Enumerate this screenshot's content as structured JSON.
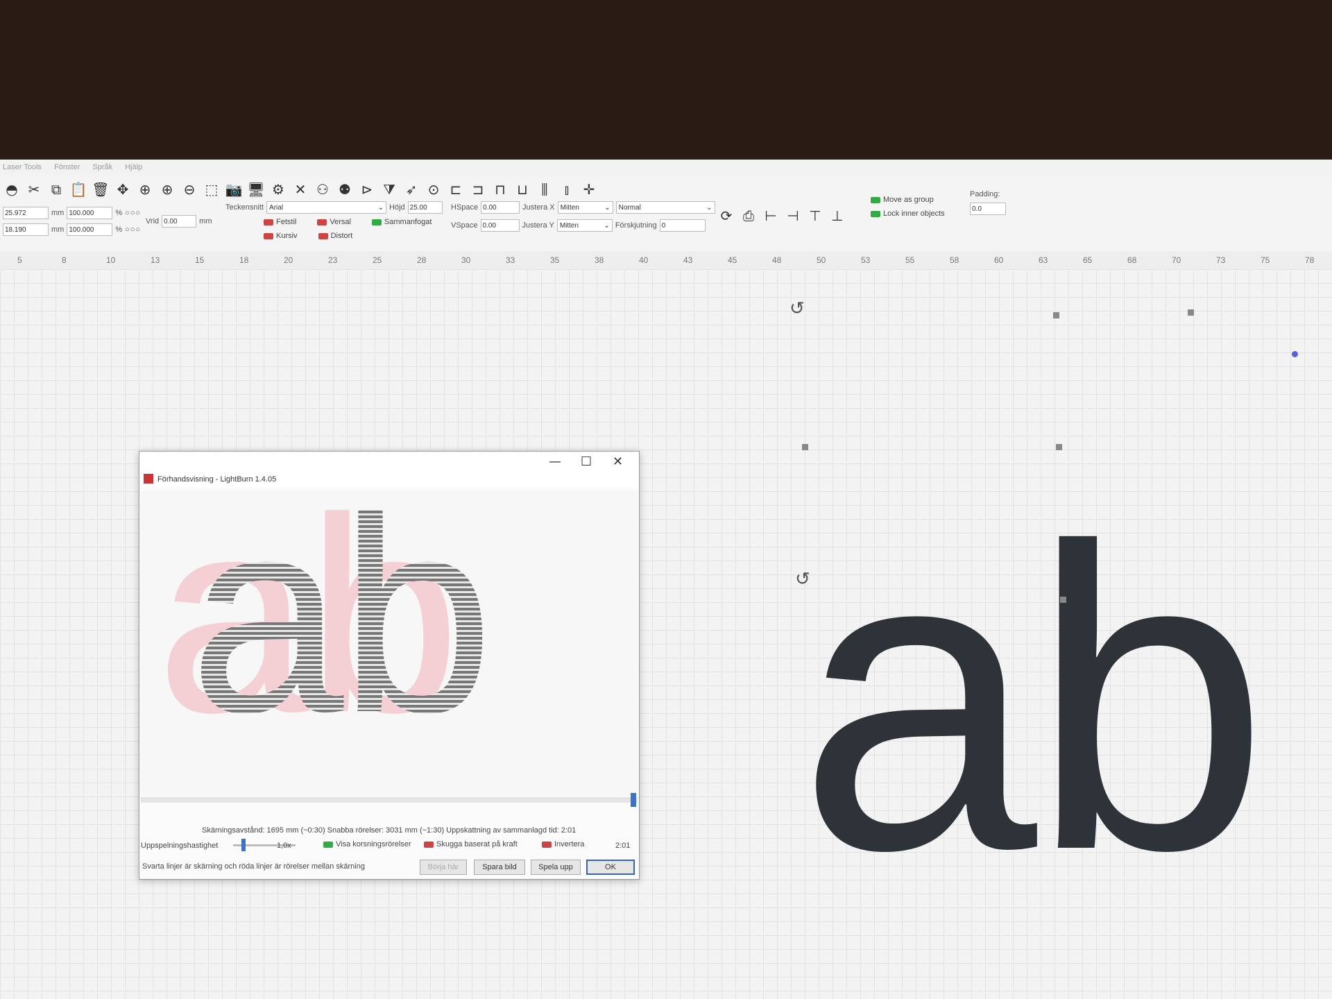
{
  "menu": [
    "Laser Tools",
    "Fönster",
    "Språk",
    "Hjälp"
  ],
  "toolbar": {
    "width": "25.972",
    "height": "18.190",
    "unit_mm": "mm",
    "scale_w": "100.000",
    "scale_h": "100.000",
    "percent": "%",
    "rotate_label": "Vrid",
    "rotate_value": "0.00",
    "font_label": "Teckensnitt",
    "font_value": "Arial",
    "bold": "Fetstil",
    "italic": "Kursiv",
    "upper": "Versal",
    "distort": "Distort",
    "welded": "Sammanfogat",
    "height_label": "Höjd",
    "height_value": "25.00",
    "hspace_label": "HSpace",
    "hspace_value": "0.00",
    "vspace_label": "VSpace",
    "vspace_value": "0.00",
    "align_x_label": "Justera X",
    "align_x_value": "Mitten",
    "align_y_label": "Justera Y",
    "align_y_value": "Mitten",
    "mode_value": "Normal",
    "offset_label": "Förskjutning",
    "offset_value": "0",
    "move_as_group": "Move as group",
    "lock_inner": "Lock inner objects",
    "padding_label": "Padding:",
    "padding_value": "0.0"
  },
  "ruler": [
    "5",
    "8",
    "10",
    "13",
    "15",
    "18",
    "20",
    "23",
    "25",
    "28",
    "30",
    "33",
    "35",
    "38",
    "40",
    "43",
    "45",
    "48",
    "50",
    "53",
    "55",
    "58",
    "60",
    "63",
    "65",
    "68",
    "70",
    "73",
    "75",
    "78"
  ],
  "canvas_text": "ab",
  "dialog": {
    "title": "Förhandsvisning - LightBurn 1.4.05",
    "preview_text": "ab",
    "stats": "Skärningsavstånd: 1695 mm (~0:30)   Snabba rörelser: 3031 mm (~1:30)   Uppskattning av sammanlagd tid: 2:01",
    "speed_label": "Uppspelningshastighet",
    "speed_value": "1,0x",
    "show_traversal": "Visa korsningsrörelser",
    "shade_power": "Skugga baserat på kraft",
    "invert": "Invertera",
    "time": "2:01",
    "legend": "Svarta linjer är skärning och röda linjer är rörelser mellan skärning",
    "btn_start": "Börja här",
    "btn_save": "Spara bild",
    "btn_play": "Spela upp",
    "btn_ok": "OK"
  }
}
